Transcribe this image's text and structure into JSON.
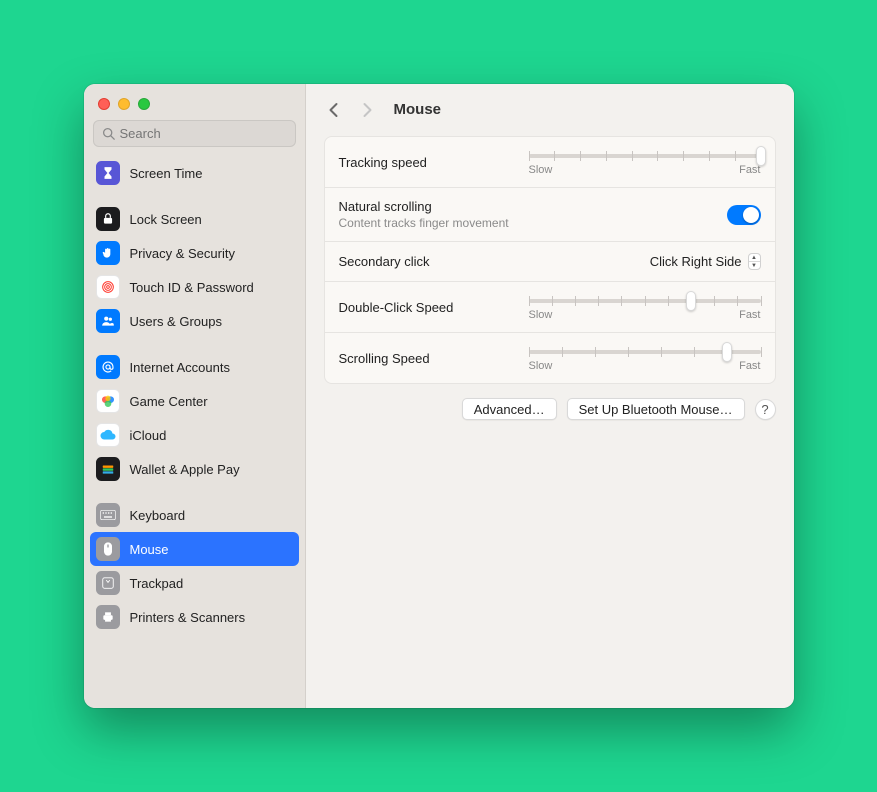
{
  "search": {
    "placeholder": "Search"
  },
  "header": {
    "title": "Mouse"
  },
  "sidebar": {
    "items": [
      {
        "label": "Screen Time",
        "icon": "hourglass-icon",
        "bg": "#5856d6"
      },
      {
        "label": "Lock Screen",
        "icon": "lock-icon",
        "bg": "#1c1c1e"
      },
      {
        "label": "Privacy & Security",
        "icon": "hand-icon",
        "bg": "#007aff"
      },
      {
        "label": "Touch ID & Password",
        "icon": "fingerprint-icon",
        "bg": "#ffffff"
      },
      {
        "label": "Users & Groups",
        "icon": "users-icon",
        "bg": "#007aff"
      },
      {
        "label": "Internet Accounts",
        "icon": "at-icon",
        "bg": "#007aff"
      },
      {
        "label": "Game Center",
        "icon": "gamecenter-icon",
        "bg": "#ffffff"
      },
      {
        "label": "iCloud",
        "icon": "cloud-icon",
        "bg": "#ffffff"
      },
      {
        "label": "Wallet & Apple Pay",
        "icon": "wallet-icon",
        "bg": "#1c1c1e"
      },
      {
        "label": "Keyboard",
        "icon": "keyboard-icon",
        "bg": "#9b9b9f"
      },
      {
        "label": "Mouse",
        "icon": "mouse-icon",
        "bg": "#9b9b9f",
        "selected": true
      },
      {
        "label": "Trackpad",
        "icon": "trackpad-icon",
        "bg": "#9b9b9f"
      },
      {
        "label": "Printers & Scanners",
        "icon": "printer-icon",
        "bg": "#9b9b9f"
      }
    ]
  },
  "settings": {
    "tracking": {
      "label": "Tracking speed",
      "low": "Slow",
      "high": "Fast",
      "ticks": 10,
      "value": 10
    },
    "natural": {
      "label": "Natural scrolling",
      "sub": "Content tracks finger movement",
      "on": true
    },
    "secondary": {
      "label": "Secondary click",
      "value": "Click Right Side"
    },
    "double": {
      "label": "Double-Click Speed",
      "low": "Slow",
      "high": "Fast",
      "ticks": 11,
      "value": 8
    },
    "scroll": {
      "label": "Scrolling Speed",
      "low": "Slow",
      "high": "Fast",
      "ticks": 8,
      "value": 7
    }
  },
  "buttons": {
    "advanced": "Advanced…",
    "bluetooth": "Set Up Bluetooth Mouse…",
    "help": "?"
  }
}
